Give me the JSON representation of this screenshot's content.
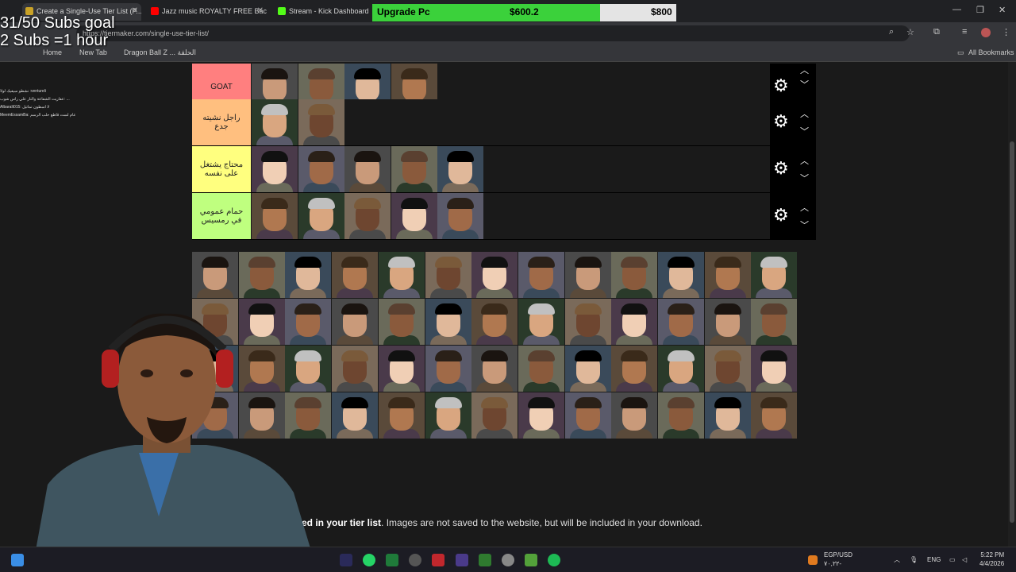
{
  "overlay": {
    "subs_goal": "31/50 Subs goal",
    "subs_rule": "2 Subs =1 hour",
    "upgrade_label": "Upgrade Pc",
    "current_amount": "$600.2",
    "goal_amount": "$800",
    "progress_fraction": 0.75,
    "progress_color": "#3bd13b"
  },
  "browser": {
    "tabs": [
      {
        "label": "Create a Single-Use Tier List (P...",
        "active": true,
        "icon_color": "#c9a227"
      },
      {
        "label": "Jazz music ROYALTY FREE Back...",
        "active": false,
        "icon_color": "#ff0000"
      },
      {
        "label": "Stream - Kick Dashboard",
        "active": false,
        "icon_color": "#53fc18"
      }
    ],
    "url": "https://tiermaker.com/single-use-tier-list/",
    "bookmarks": [
      "Home",
      "New Tab",
      "Dragon Ball Z ... الحلقة"
    ],
    "all_bookmarks": "All Bookmarks"
  },
  "chat": {
    "lines": [
      "نشطو سيفيك لولا :ventureli",
      "عفاريت الشفاعة والنار علي راس شوب: ...",
      "Albaralt015: لا اسطون تماثيل",
      "MeemEssamBa: عام لست قاطع حلب الرسم"
    ]
  },
  "tiers": [
    {
      "label": "GOAT",
      "color": "#ff7f7f",
      "count": 4
    },
    {
      "label": "راجل نشيته جدع",
      "color": "#ffbf7f",
      "count": 2
    },
    {
      "label": "محتاج يشتغل على نفسه",
      "color": "#ffff7f",
      "count": 5
    },
    {
      "label": "حمام عمومي في رمسيس",
      "color": "#bfff7f",
      "count": 5
    }
  ],
  "pool": {
    "rows": 4,
    "cols": 13
  },
  "footer": {
    "bold": "ed in your tier list",
    "rest": ". Images are not saved to the website, but will be included in your download."
  },
  "taskbar": {
    "currency": "EGP/USD",
    "currency_value": "٧٠,٢٢-",
    "language": "ENG",
    "time": "5:22 PM",
    "date": "4/4/2026"
  },
  "icons": {
    "gear": "gear-icon",
    "up": "chevron-up-icon",
    "down": "chevron-down-icon"
  }
}
